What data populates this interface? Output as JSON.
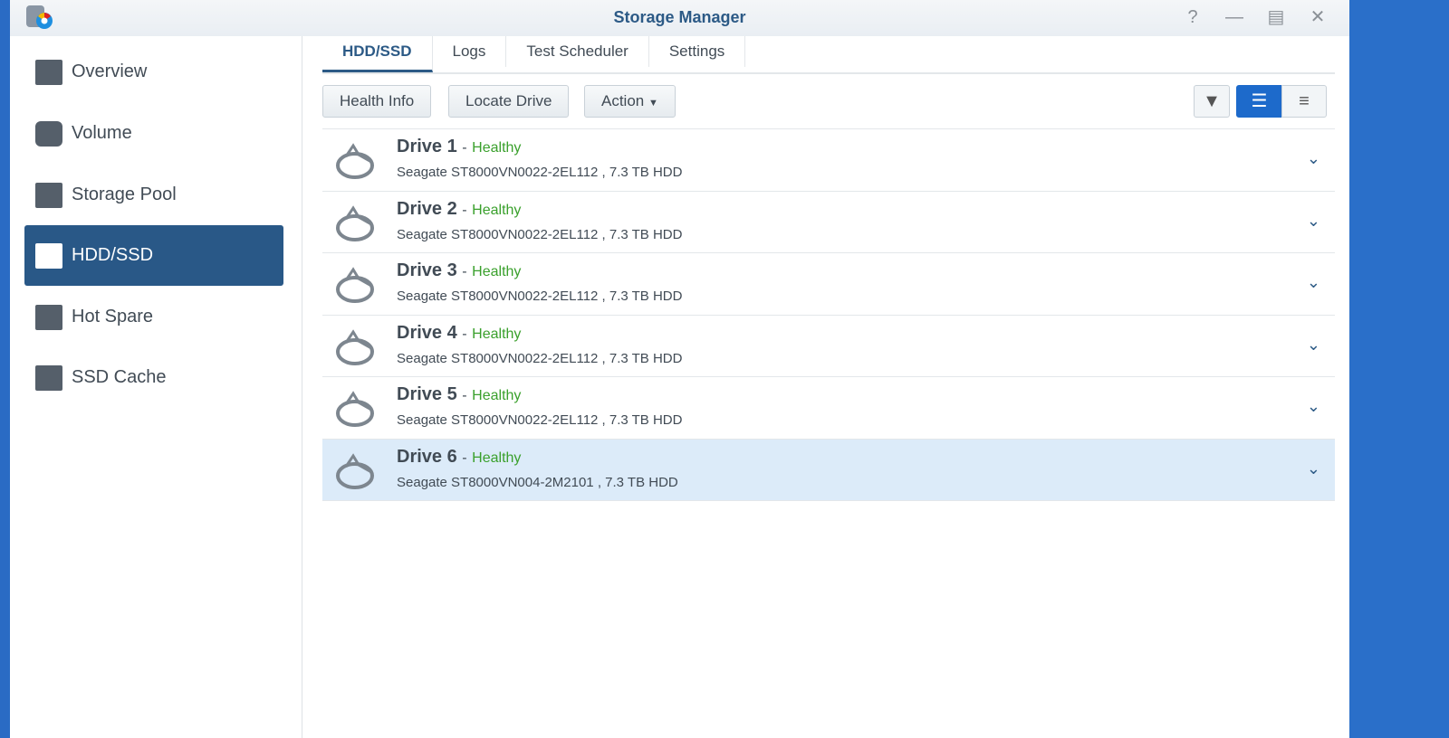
{
  "window": {
    "title": "Storage Manager"
  },
  "sidebar": {
    "items": [
      {
        "label": "Overview"
      },
      {
        "label": "Volume"
      },
      {
        "label": "Storage Pool"
      },
      {
        "label": "HDD/SSD"
      },
      {
        "label": "Hot Spare"
      },
      {
        "label": "SSD Cache"
      }
    ]
  },
  "tabs": [
    {
      "label": "HDD/SSD"
    },
    {
      "label": "Logs"
    },
    {
      "label": "Test Scheduler"
    },
    {
      "label": "Settings"
    }
  ],
  "toolbar": {
    "health_info": "Health Info",
    "locate_drive": "Locate Drive",
    "action": "Action"
  },
  "drives": [
    {
      "name": "Drive 1",
      "sep": "-",
      "status": "Healthy",
      "desc": "Seagate ST8000VN0022-2EL112 , 7.3 TB HDD"
    },
    {
      "name": "Drive 2",
      "sep": "-",
      "status": "Healthy",
      "desc": "Seagate ST8000VN0022-2EL112 , 7.3 TB HDD"
    },
    {
      "name": "Drive 3",
      "sep": "-",
      "status": "Healthy",
      "desc": "Seagate ST8000VN0022-2EL112 , 7.3 TB HDD"
    },
    {
      "name": "Drive 4",
      "sep": "-",
      "status": "Healthy",
      "desc": "Seagate ST8000VN0022-2EL112 , 7.3 TB HDD"
    },
    {
      "name": "Drive 5",
      "sep": "-",
      "status": "Healthy",
      "desc": "Seagate ST8000VN0022-2EL112 , 7.3 TB HDD"
    },
    {
      "name": "Drive 6",
      "sep": "-",
      "status": "Healthy",
      "desc": "Seagate ST8000VN004-2M2101 , 7.3 TB HDD"
    }
  ]
}
